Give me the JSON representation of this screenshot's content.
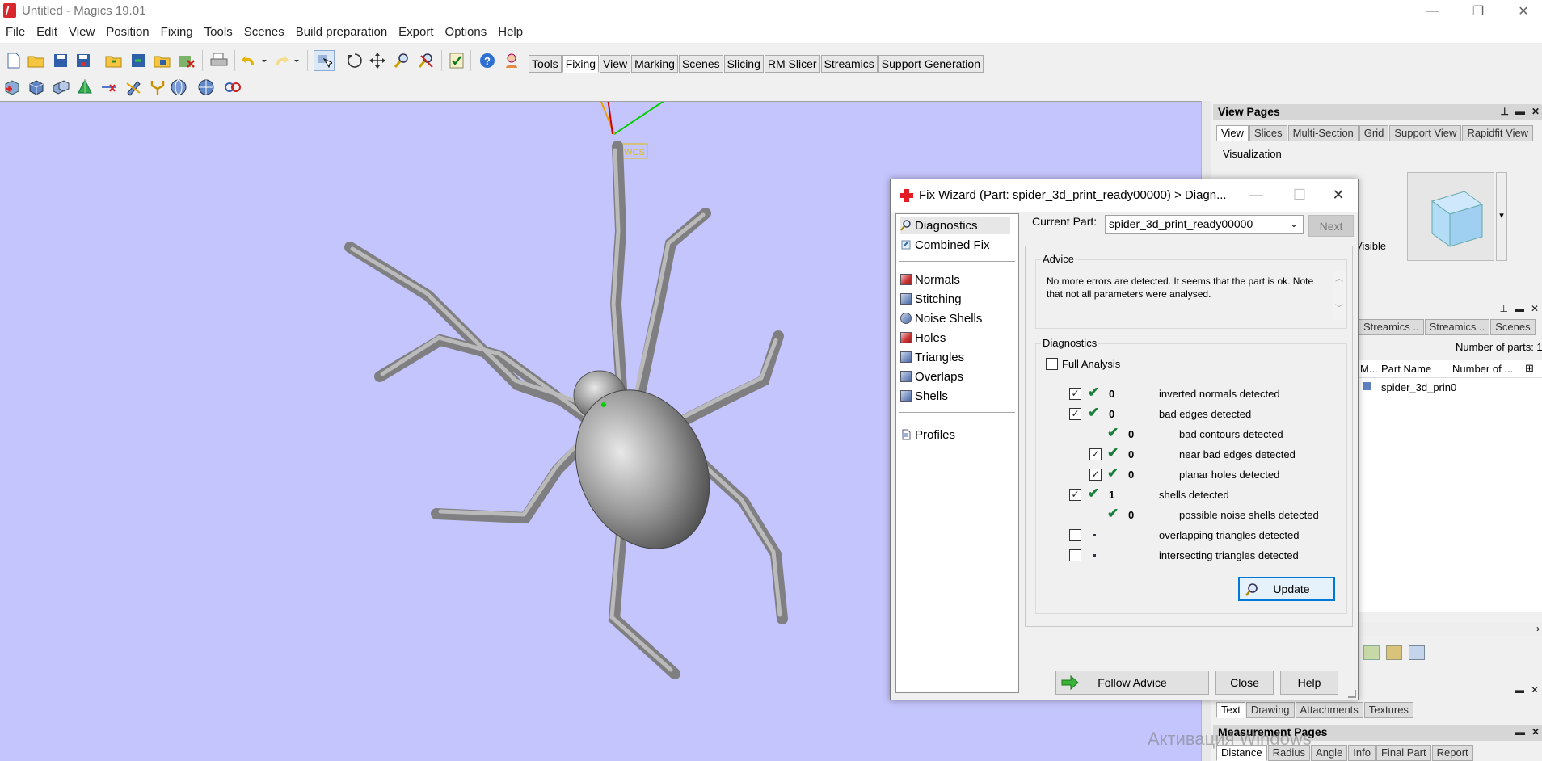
{
  "window": {
    "title": "Untitled - Magics 19.01",
    "minimize_icon": "—",
    "maximize_icon": "❐",
    "close_icon": "✕"
  },
  "menu": [
    "File",
    "Edit",
    "View",
    "Position",
    "Fixing",
    "Tools",
    "Scenes",
    "Build preparation",
    "Export",
    "Options",
    "Help"
  ],
  "toolbar_tabs": [
    "Tools",
    "Fixing",
    "View",
    "Marking",
    "Scenes",
    "Slicing",
    "RM Slicer",
    "Streamics",
    "Support Generation"
  ],
  "toolbar_active_tab": "Fixing",
  "viewport": {
    "background": "#c5c5fd",
    "model": "spider_3d_print_ready00000",
    "axis_label": "WCS"
  },
  "view_pages": {
    "title": "View Pages",
    "tabs": [
      "View",
      "Slices",
      "Multi-Section",
      "Grid",
      "Support View",
      "Rapidfit View"
    ],
    "active_tab": "View",
    "section": "Visualization",
    "partial_label": "Visible"
  },
  "parts_panel": {
    "tabs": [
      "Streamics ..",
      "Streamics ..",
      "Scenes"
    ],
    "count_label": "Number of parts: 1",
    "columns": [
      "M...",
      "Part Name",
      "Number of ..."
    ],
    "rows": [
      {
        "name": "spider_3d_prin",
        "count": "0"
      }
    ]
  },
  "object_pages": {
    "tabs": [
      "Text",
      "Drawing",
      "Attachments",
      "Textures"
    ],
    "active_tab": "Text"
  },
  "measurement_pages": {
    "title": "Measurement Pages",
    "tabs": [
      "Distance",
      "Radius",
      "Angle",
      "Info",
      "Final Part",
      "Report"
    ],
    "active_tab": "Distance"
  },
  "fix_wizard": {
    "title": "Fix Wizard (Part: spider_3d_print_ready00000) > Diagn...",
    "nav": {
      "top": [
        "Diagnostics",
        "Combined Fix"
      ],
      "tools": [
        "Normals",
        "Stitching",
        "Noise Shells",
        "Holes",
        "Triangles",
        "Overlaps",
        "Shells"
      ],
      "bottom": [
        "Profiles"
      ],
      "active": "Diagnostics"
    },
    "current_part_label": "Current Part:",
    "current_part": "spider_3d_print_ready00000",
    "next_label": "Next",
    "advice_group": "Advice",
    "advice_text": "No more errors are detected. It seems that the part is ok. Note that not all parameters were analysed.",
    "diagnostics_group": "Diagnostics",
    "full_analysis_label": "Full Analysis",
    "full_analysis_checked": false,
    "checks": [
      {
        "label": "inverted normals detected",
        "count": "0",
        "checked": true,
        "ok": true,
        "indent": 0
      },
      {
        "label": "bad edges detected",
        "count": "0",
        "checked": true,
        "ok": true,
        "indent": 0
      },
      {
        "label": "bad contours detected",
        "count": "0",
        "checked": null,
        "ok": true,
        "indent": 1
      },
      {
        "label": "near bad edges detected",
        "count": "0",
        "checked": true,
        "ok": true,
        "indent": 1
      },
      {
        "label": "planar holes detected",
        "count": "0",
        "checked": true,
        "ok": true,
        "indent": 1
      },
      {
        "label": "shells detected",
        "count": "1",
        "checked": true,
        "ok": true,
        "indent": 0
      },
      {
        "label": "possible noise shells detected",
        "count": "0",
        "checked": null,
        "ok": true,
        "indent": 1
      },
      {
        "label": "overlapping triangles detected",
        "count": "",
        "checked": false,
        "ok": false,
        "indent": 0
      },
      {
        "label": "intersecting triangles detected",
        "count": "",
        "checked": false,
        "ok": false,
        "indent": 0
      }
    ],
    "update_label": "Update",
    "follow_advice_label": "Follow Advice",
    "close_label": "Close",
    "help_label": "Help"
  },
  "watermark": "Активация Windows",
  "colors": {
    "viewport": "#c5c5fd",
    "check_ok": "#1a7e3c",
    "focus": "#0078d7",
    "brand": "#d9282d"
  }
}
